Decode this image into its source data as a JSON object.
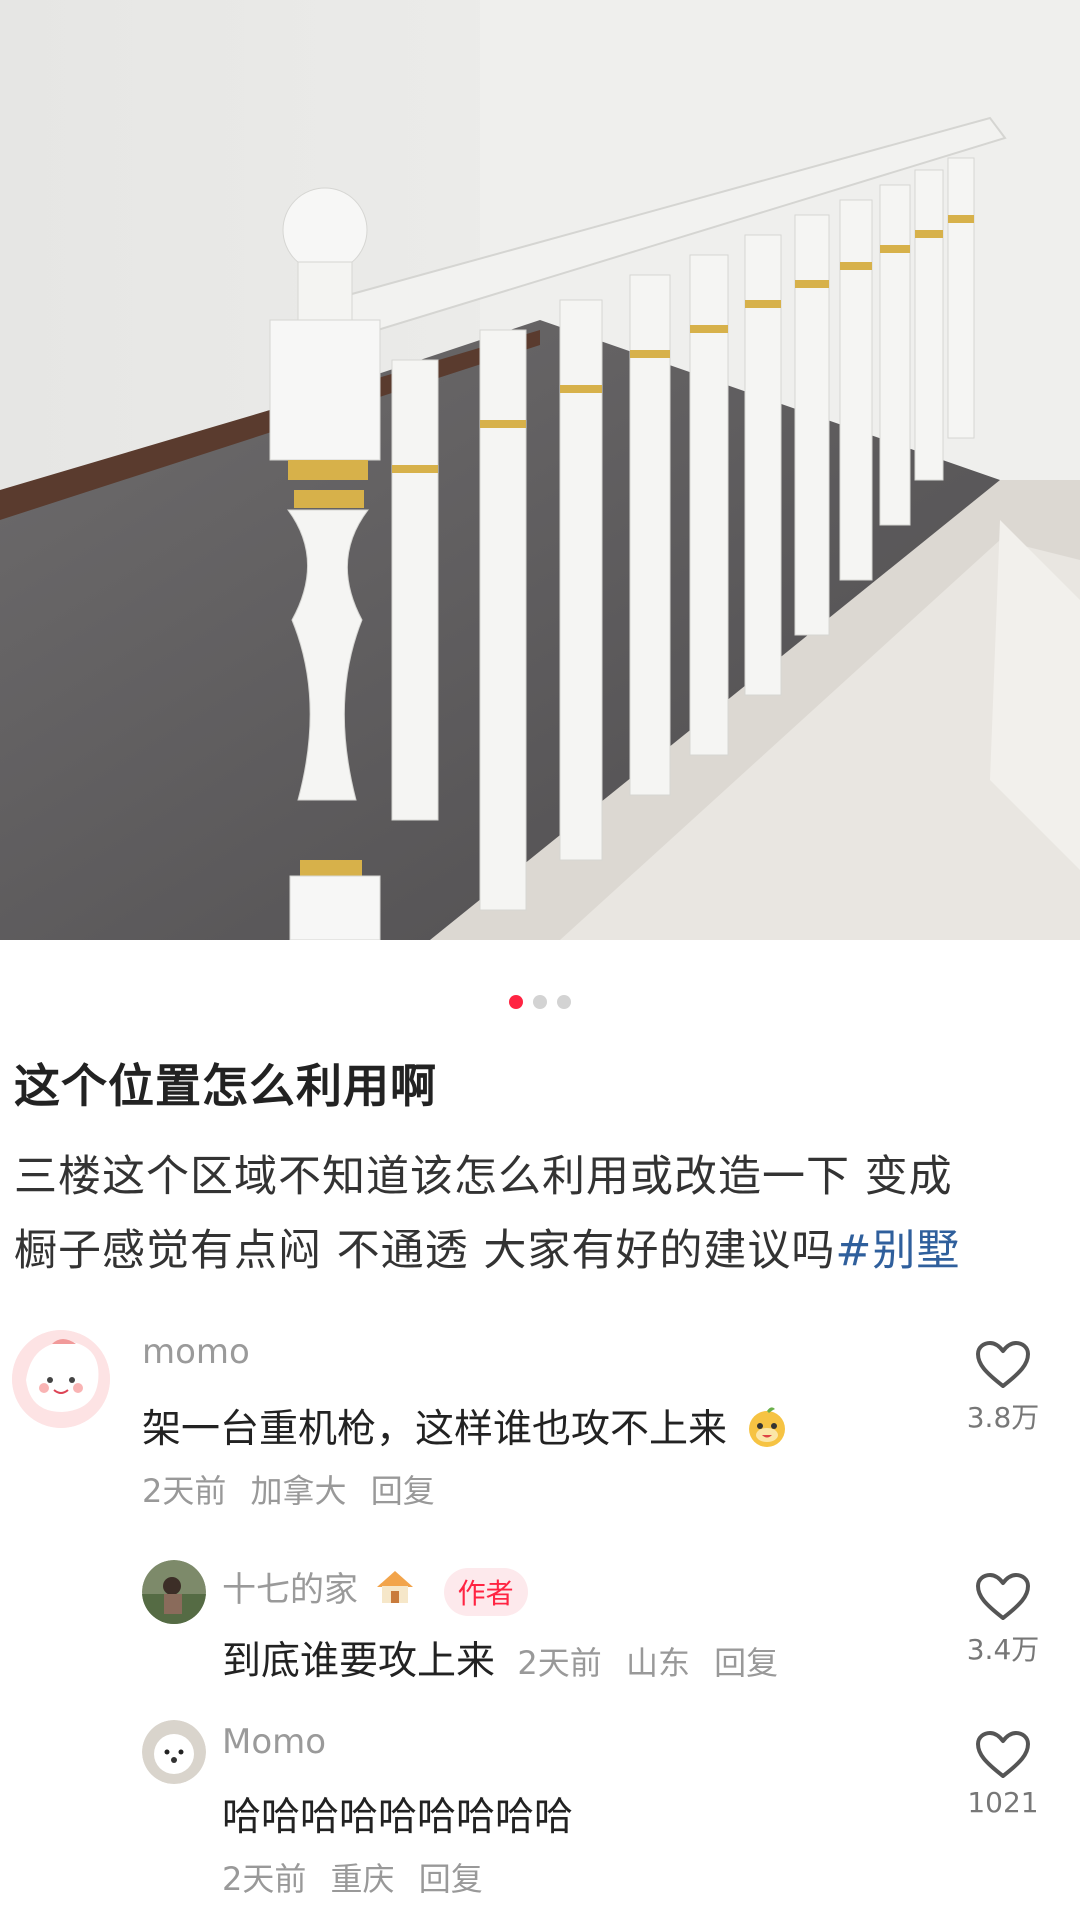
{
  "post": {
    "title": "这个位置怎么利用啊",
    "desc_line1": "三楼这个区域不知道该怎么利用或改造一下 变成",
    "desc_line2": "橱子感觉有点闷 不通透 大家有好的建议吗",
    "hashtag": "#别墅",
    "carousel": {
      "count": 3,
      "active_index": 0
    }
  },
  "comments": [
    {
      "user": "momo",
      "text": "架一台重机枪，这样谁也攻不上来",
      "time": "2天前",
      "location": "加拿大",
      "reply_label": "回复",
      "likes": "3.8万"
    }
  ],
  "replies": [
    {
      "user": "十七的家",
      "author_tag": "作者",
      "text": "到底谁要攻上来",
      "time": "2天前",
      "location": "山东",
      "reply_label": "回复",
      "likes": "3.4万"
    },
    {
      "user": "Momo",
      "text": "哈哈哈哈哈哈哈哈哈",
      "time": "2天前",
      "location": "重庆",
      "reply_label": "回复",
      "likes": "1021"
    }
  ],
  "colors": {
    "accent": "#ff2442",
    "hashtag": "#2f5f9c"
  },
  "icons": [
    "heart-icon",
    "house-emoji-icon",
    "smile-emoji-icon"
  ]
}
